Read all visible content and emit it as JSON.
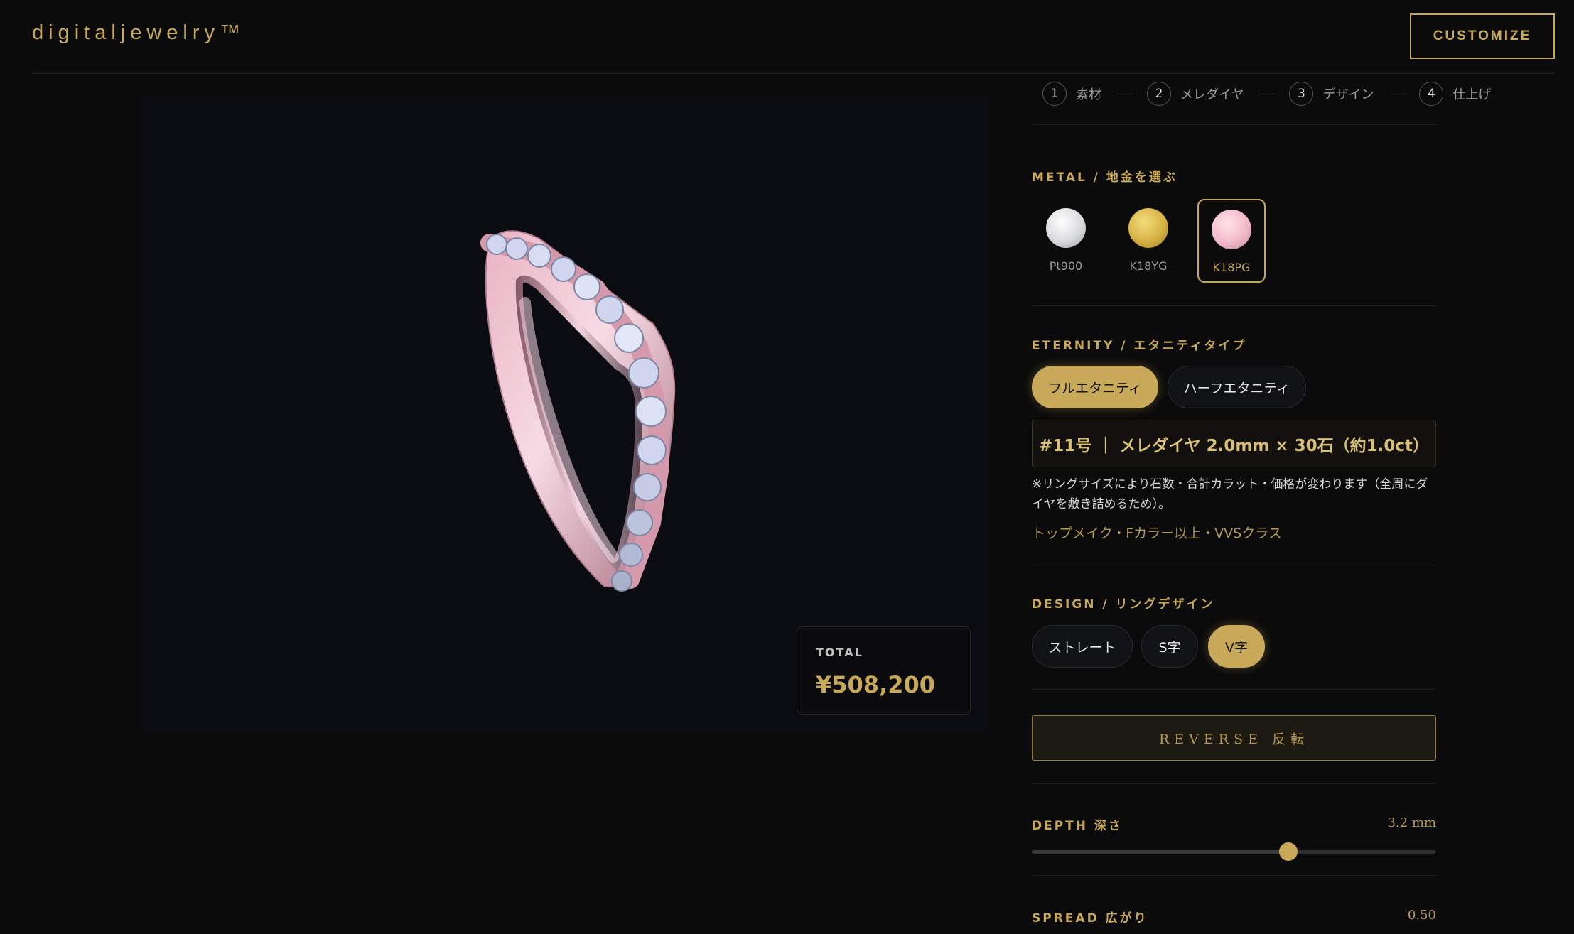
{
  "header": {
    "logo": "digitaljewelry™",
    "customize_label": "CUSTOMIZE"
  },
  "viewer": {
    "total_label": "TOTAL",
    "total_value": "¥508,200",
    "ring_metal_color": "#e8b6c3",
    "diamond_color": "#cfd6ee"
  },
  "stepper": [
    {
      "num": "1",
      "label": "素材"
    },
    {
      "num": "2",
      "label": "メレダイヤ"
    },
    {
      "num": "3",
      "label": "デザイン"
    },
    {
      "num": "4",
      "label": "仕上げ"
    }
  ],
  "metal": {
    "title": "METAL / 地金を選ぶ",
    "options": [
      {
        "label": "Pt900",
        "color": "#d9dadc"
      },
      {
        "label": "K18YG",
        "color": "#d6b244"
      },
      {
        "label": "K18PG",
        "color": "#f2b9c8"
      }
    ],
    "selected": "K18PG"
  },
  "eternity": {
    "title": "ETERNITY / エタニティタイプ",
    "options": [
      "フルエタニティ",
      "ハーフエタニティ"
    ],
    "selected": "フルエタニティ",
    "info": "#11号 ｜ メレダイヤ 2.0mm × 30石（約1.0ct）",
    "note": "※リングサイズにより石数・合計カラット・価格が変わります（全周にダイヤを敷き詰めるため）。",
    "spec": "トップメイク・Fカラー以上・VVSクラス"
  },
  "design": {
    "title": "DESIGN / リングデザイン",
    "options": [
      "ストレート",
      "S字",
      "V字"
    ],
    "selected": "V字"
  },
  "reverse": {
    "label": "REVERSE 反転"
  },
  "depth": {
    "title": "DEPTH 深さ",
    "value_label": "3.2 mm",
    "fraction": 0.635
  },
  "spread": {
    "title": "SPREAD 広がり",
    "value_label": "0.50"
  },
  "accent_color": "#c8a95a"
}
